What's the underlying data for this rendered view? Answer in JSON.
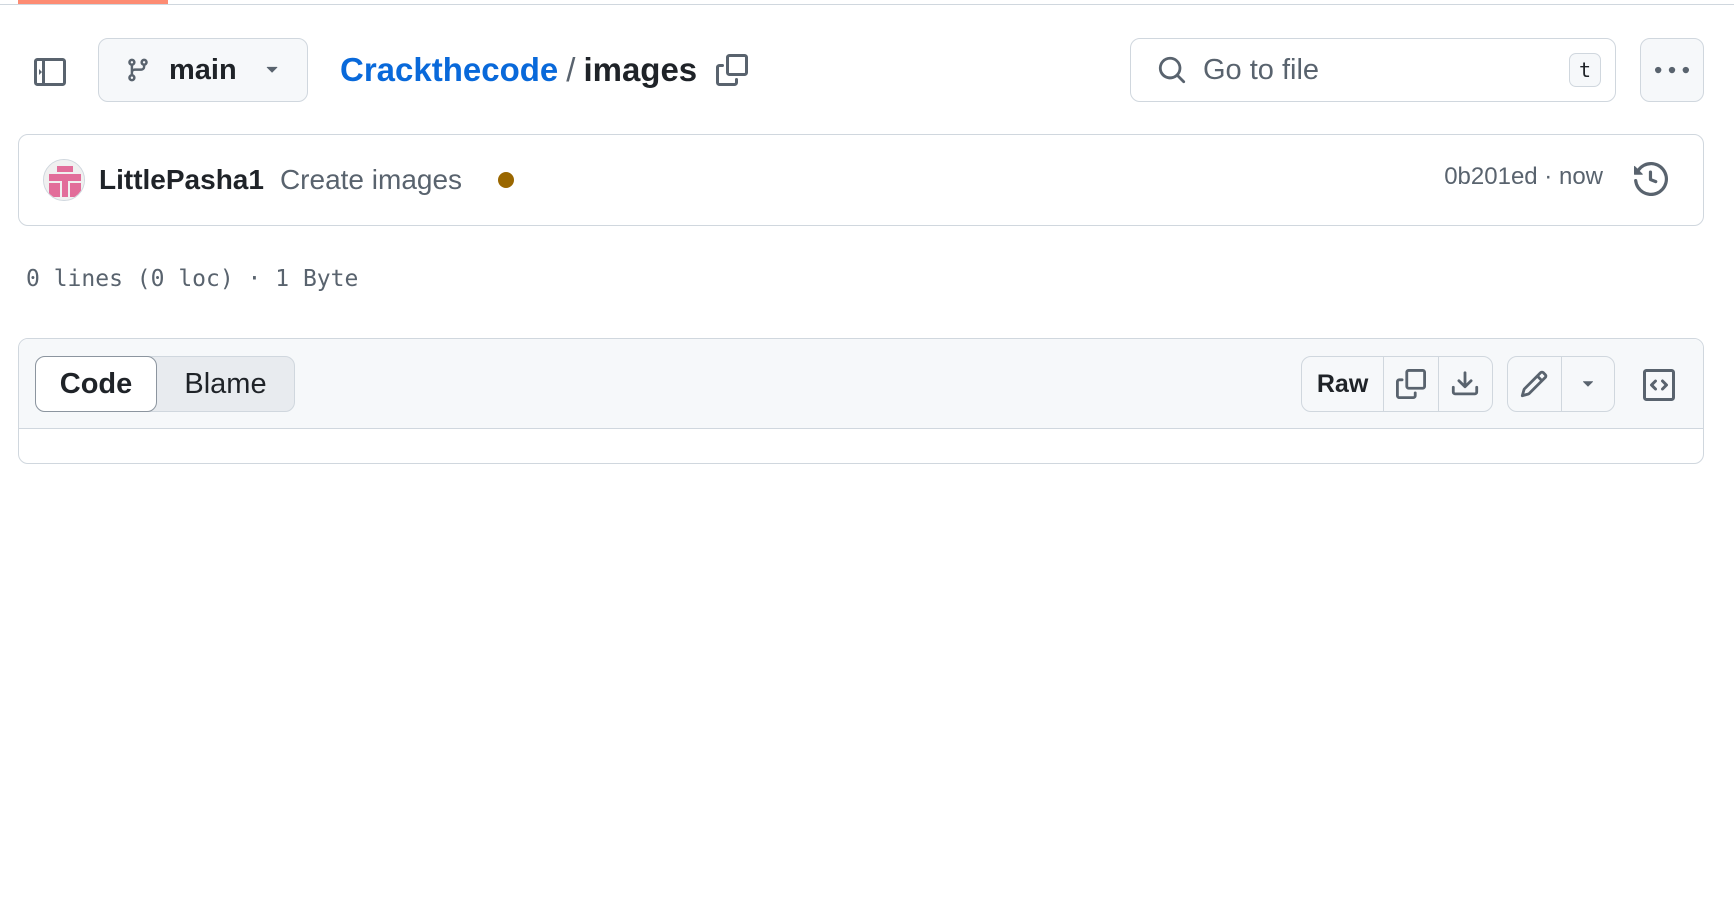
{
  "header": {
    "branch": "main",
    "breadcrumb": {
      "repo": "Crackthecode",
      "separator": "/",
      "file": "images"
    },
    "search": {
      "placeholder": "Go to file",
      "shortcut": "t"
    }
  },
  "commit": {
    "author": "LittlePasha1",
    "message": "Create images",
    "status_color": "#9a6700",
    "meta": "0b201ed · now"
  },
  "file_info": "0 lines (0 loc) · 1 Byte",
  "toolbar": {
    "tabs": [
      {
        "label": "Code",
        "active": true
      },
      {
        "label": "Blame",
        "active": false
      }
    ],
    "raw_label": "Raw"
  },
  "colors": {
    "link": "#0969da",
    "accent_underline": "#fd8c73",
    "border": "#d0d7de",
    "muted_text": "#59636e"
  },
  "icons": [
    "sidebar-expand-icon",
    "git-branch-icon",
    "triangle-down-icon",
    "copy-icon",
    "search-icon",
    "kebab-horizontal-icon",
    "history-icon",
    "download-icon",
    "pencil-icon",
    "code-square-icon"
  ]
}
